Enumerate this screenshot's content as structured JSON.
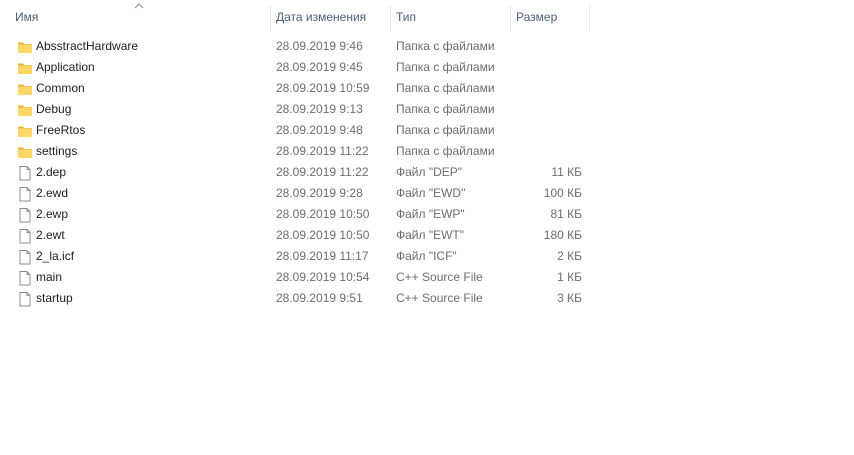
{
  "columns": {
    "name": "Имя",
    "date": "Дата изменения",
    "type": "Тип",
    "size": "Размер"
  },
  "sort": {
    "column": "name",
    "direction": "ascending"
  },
  "colors": {
    "folder": "#ffd766",
    "folder_dark": "#e8b43c",
    "header_text": "#4c607a",
    "secondary_text": "#6d6d6d"
  },
  "files": [
    {
      "name": "AbsstractHardware",
      "date": "28.09.2019 9:46",
      "type": "Папка с файлами",
      "size": "",
      "icon": "folder-icon"
    },
    {
      "name": "Application",
      "date": "28.09.2019 9:45",
      "type": "Папка с файлами",
      "size": "",
      "icon": "folder-icon"
    },
    {
      "name": "Common",
      "date": "28.09.2019 10:59",
      "type": "Папка с файлами",
      "size": "",
      "icon": "folder-icon"
    },
    {
      "name": "Debug",
      "date": "28.09.2019 9:13",
      "type": "Папка с файлами",
      "size": "",
      "icon": "folder-icon"
    },
    {
      "name": "FreeRtos",
      "date": "28.09.2019 9:48",
      "type": "Папка с файлами",
      "size": "",
      "icon": "folder-icon"
    },
    {
      "name": "settings",
      "date": "28.09.2019 11:22",
      "type": "Папка с файлами",
      "size": "",
      "icon": "folder-icon"
    },
    {
      "name": "2.dep",
      "date": "28.09.2019 11:22",
      "type": "Файл \"DEP\"",
      "size": "11 КБ",
      "icon": "file-icon"
    },
    {
      "name": "2.ewd",
      "date": "28.09.2019 9:28",
      "type": "Файл \"EWD\"",
      "size": "100 КБ",
      "icon": "file-icon"
    },
    {
      "name": "2.ewp",
      "date": "28.09.2019 10:50",
      "type": "Файл \"EWP\"",
      "size": "81 КБ",
      "icon": "file-icon"
    },
    {
      "name": "2.ewt",
      "date": "28.09.2019 10:50",
      "type": "Файл \"EWT\"",
      "size": "180 КБ",
      "icon": "file-icon"
    },
    {
      "name": "2_la.icf",
      "date": "28.09.2019 11:17",
      "type": "Файл \"ICF\"",
      "size": "2 КБ",
      "icon": "file-icon"
    },
    {
      "name": "main",
      "date": "28.09.2019 10:54",
      "type": "C++ Source File",
      "size": "1 КБ",
      "icon": "file-icon"
    },
    {
      "name": "startup",
      "date": "28.09.2019 9:51",
      "type": "C++ Source File",
      "size": "3 КБ",
      "icon": "file-icon"
    }
  ]
}
